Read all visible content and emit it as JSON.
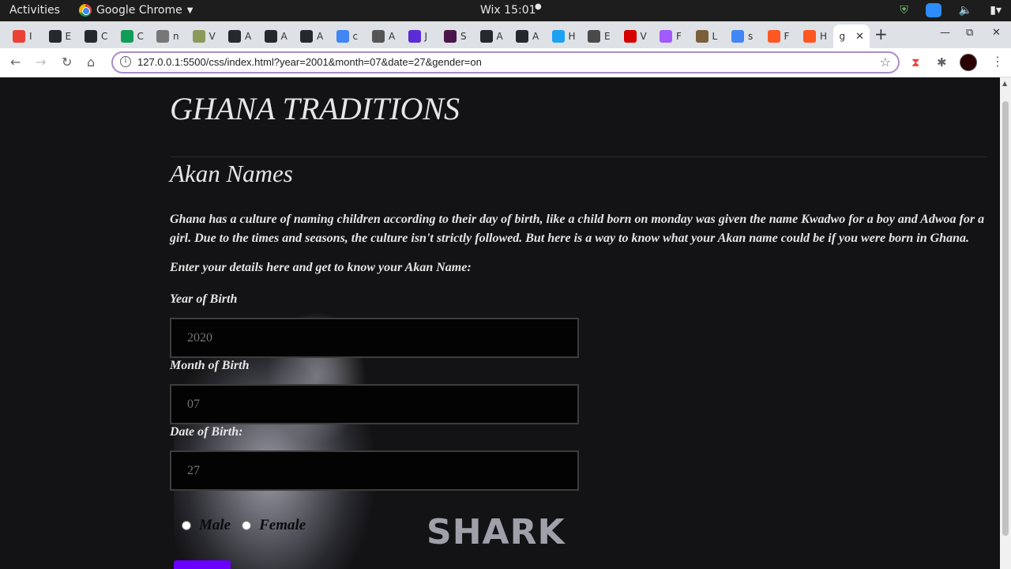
{
  "system_bar": {
    "activities": "Activities",
    "app_name": "Google Chrome",
    "clock": "Wix 15:01"
  },
  "browser": {
    "tabs": [
      {
        "label": "I",
        "favicon": "gmail-icon",
        "color": "#ea4335"
      },
      {
        "label": "E",
        "favicon": "github-icon",
        "color": "#24292e"
      },
      {
        "label": "C",
        "favicon": "github-icon",
        "color": "#24292e"
      },
      {
        "label": "C",
        "favicon": "sheets-icon",
        "color": "#0f9d58"
      },
      {
        "label": "n",
        "favicon": "globe-icon",
        "color": "#777777"
      },
      {
        "label": "V",
        "favicon": "plant-icon",
        "color": "#8a9a5b"
      },
      {
        "label": "A",
        "favicon": "github-icon",
        "color": "#24292e"
      },
      {
        "label": "A",
        "favicon": "github-icon",
        "color": "#24292e"
      },
      {
        "label": "A",
        "favicon": "github-icon",
        "color": "#24292e"
      },
      {
        "label": "c",
        "favicon": "google-icon",
        "color": "#4285f4"
      },
      {
        "label": "A",
        "favicon": "globe-icon",
        "color": "#555555"
      },
      {
        "label": "J",
        "favicon": "jira-icon",
        "color": "#5b2bd6"
      },
      {
        "label": "S",
        "favicon": "slack-icon",
        "color": "#4a154b"
      },
      {
        "label": "A",
        "favicon": "github-icon",
        "color": "#24292e"
      },
      {
        "label": "A",
        "favicon": "github-icon",
        "color": "#24292e"
      },
      {
        "label": "H",
        "favicon": "twitter-icon",
        "color": "#1da1f2"
      },
      {
        "label": "E",
        "favicon": "doc-icon",
        "color": "#4a4a4a"
      },
      {
        "label": "V",
        "favicon": "alert-icon",
        "color": "#d50000"
      },
      {
        "label": "F",
        "favicon": "figma-icon",
        "color": "#a259ff"
      },
      {
        "label": "L",
        "favicon": "bowl-icon",
        "color": "#7b5e3b"
      },
      {
        "label": "s",
        "favicon": "google-icon",
        "color": "#4285f4"
      },
      {
        "label": "F",
        "favicon": "chat-icon",
        "color": "#ff5722"
      },
      {
        "label": "H",
        "favicon": "blogger-icon",
        "color": "#ff5722"
      },
      {
        "label": "g",
        "favicon": "none",
        "color": "#ffffff"
      }
    ],
    "url": "127.0.0.1:5500/css/index.html?year=2001&month=07&date=27&gender=on"
  },
  "page": {
    "site_title": "GHANA TRADITIONS",
    "section_title": "Akan Names",
    "intro": "Ghana has a culture of naming children according to their day of birth, like a child born on monday was given the name Kwadwo for a boy and Adwoa for a girl. Due to the times and seasons, the culture isn't strictly followed. But here is a way to know what your Akan name could be if you were born in Ghana.",
    "prompt": "Enter your details here and get to know your Akan Name:",
    "form": {
      "year_label": "Year of Birth",
      "year_placeholder": "2020",
      "month_label": "Month of Birth",
      "month_placeholder": "07",
      "date_label": "Date of Birth:",
      "date_placeholder": "27",
      "male_label": "Male",
      "female_label": "Female"
    },
    "background_text": "SHARK"
  }
}
